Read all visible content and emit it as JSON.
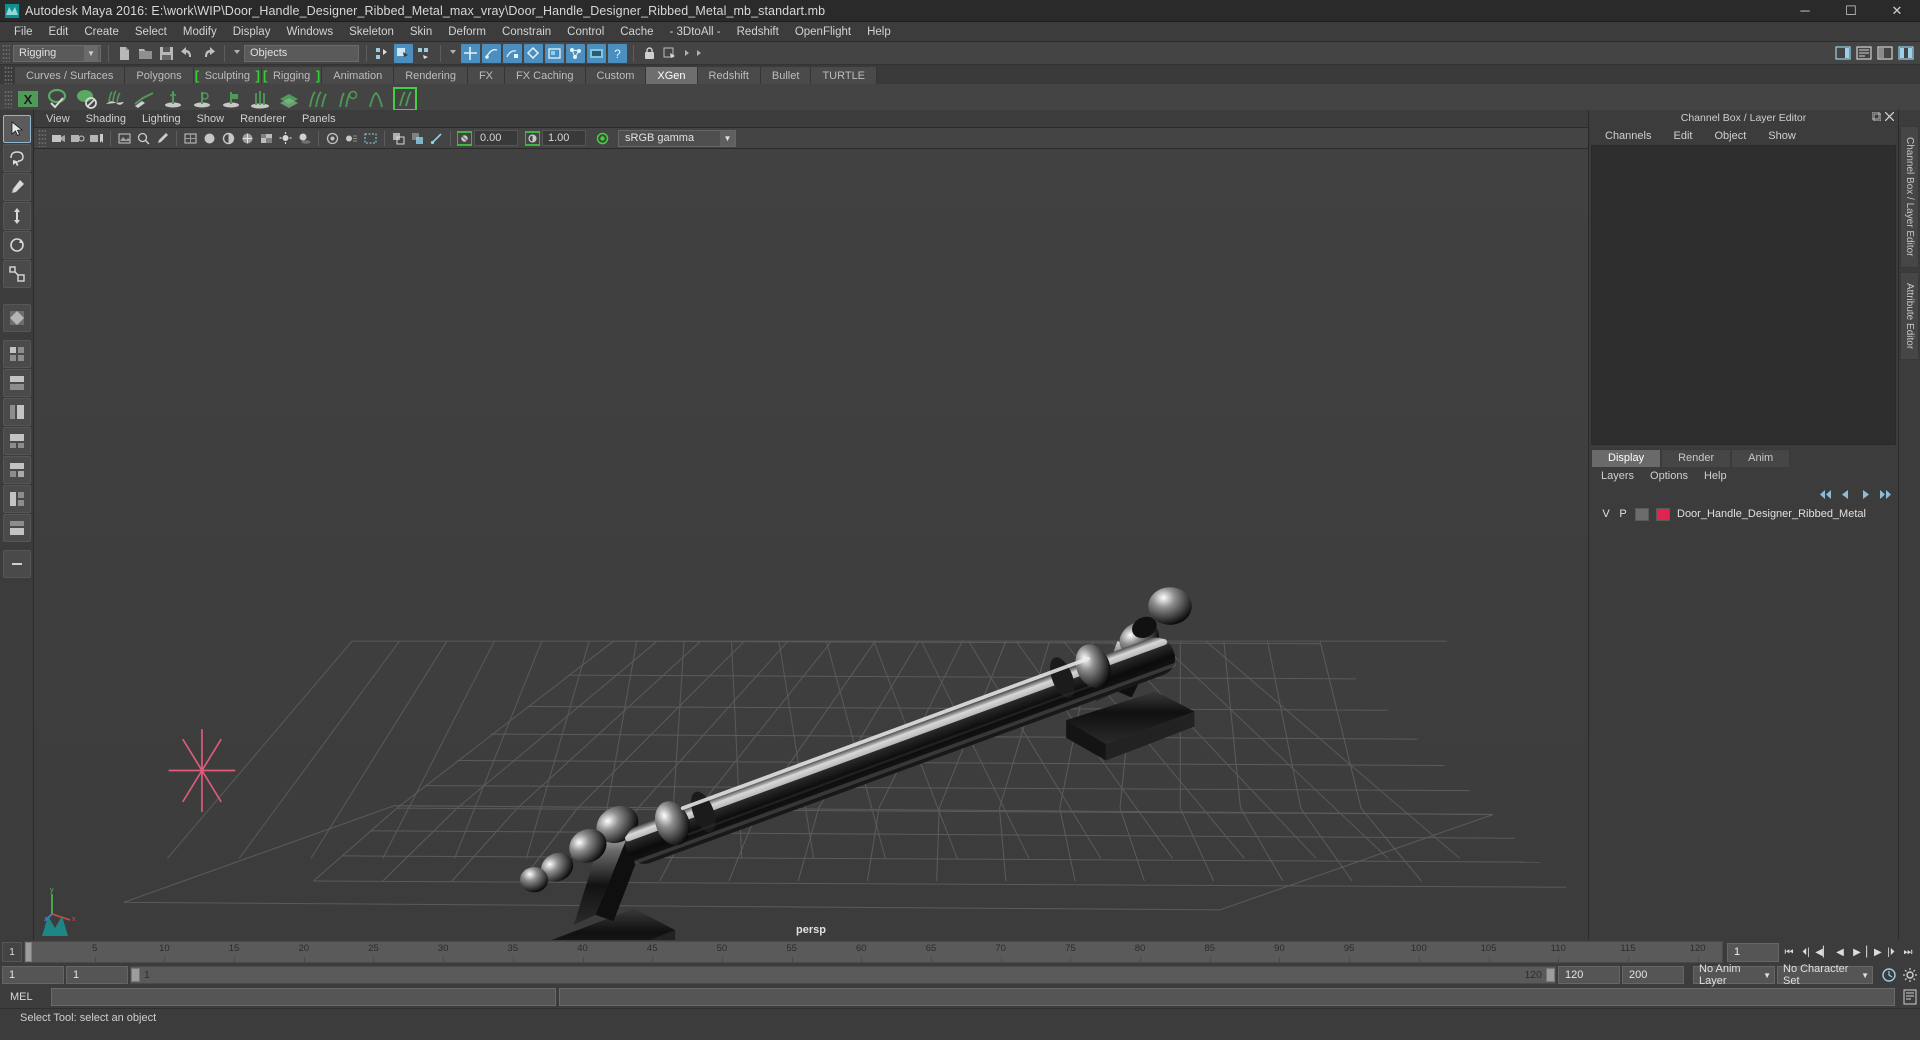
{
  "titlebar": {
    "title": "Autodesk Maya 2016: E:\\work\\WIP\\Door_Handle_Designer_Ribbed_Metal_max_vray\\Door_Handle_Designer_Ribbed_Metal_mb_standart.mb",
    "minimize": "─",
    "maximize": "☐",
    "close": "✕"
  },
  "menubar": {
    "items": [
      {
        "label": "File"
      },
      {
        "label": "Edit"
      },
      {
        "label": "Create"
      },
      {
        "label": "Select"
      },
      {
        "label": "Modify"
      },
      {
        "label": "Display"
      },
      {
        "label": "Windows"
      },
      {
        "label": "Skeleton"
      },
      {
        "label": "Skin"
      },
      {
        "label": "Deform"
      },
      {
        "label": "Constrain"
      },
      {
        "label": "Control"
      },
      {
        "label": "Cache"
      },
      {
        "label": "- 3DtoAll -"
      },
      {
        "label": "Redshift"
      },
      {
        "label": "OpenFlight"
      },
      {
        "label": "Help"
      }
    ]
  },
  "statusline": {
    "menuset": "Rigging",
    "selection_mask": "Objects",
    "arrow": "▼"
  },
  "shelf": {
    "tabs": [
      {
        "label": "Curves / Surfaces",
        "active": false,
        "lbracket": "",
        "rbracket": ""
      },
      {
        "label": "Polygons",
        "active": false,
        "lbracket": "",
        "rbracket": ""
      },
      {
        "label": "Sculpting",
        "active": false,
        "lbracket": "[",
        "rbracket": "]"
      },
      {
        "label": "Rigging",
        "active": false,
        "lbracket": "[",
        "rbracket": "]"
      },
      {
        "label": "Animation",
        "active": false,
        "lbracket": "",
        "rbracket": ""
      },
      {
        "label": "Rendering",
        "active": false,
        "lbracket": "",
        "rbracket": ""
      },
      {
        "label": "FX",
        "active": false,
        "lbracket": "",
        "rbracket": ""
      },
      {
        "label": "FX Caching",
        "active": false,
        "lbracket": "",
        "rbracket": ""
      },
      {
        "label": "Custom",
        "active": false,
        "lbracket": "",
        "rbracket": ""
      },
      {
        "label": "XGen",
        "active": true,
        "lbracket": "",
        "rbracket": ""
      },
      {
        "label": "Redshift",
        "active": false,
        "lbracket": "",
        "rbracket": ""
      },
      {
        "label": "Bullet",
        "active": false,
        "lbracket": "",
        "rbracket": ""
      },
      {
        "label": "TURTLE",
        "active": false,
        "lbracket": "",
        "rbracket": ""
      }
    ]
  },
  "viewport": {
    "menu": [
      {
        "label": "View"
      },
      {
        "label": "Shading"
      },
      {
        "label": "Lighting"
      },
      {
        "label": "Show"
      },
      {
        "label": "Renderer"
      },
      {
        "label": "Panels"
      }
    ],
    "exposure": "0.00",
    "gamma": "1.00",
    "colorspace": "sRGB gamma",
    "camera_label": "persp",
    "axis_x": "x",
    "axis_y": "y",
    "axis_z": "z"
  },
  "channelbox": {
    "panel_title": "Channel Box / Layer Editor",
    "tabs": [
      {
        "label": "Channels"
      },
      {
        "label": "Edit"
      },
      {
        "label": "Object"
      },
      {
        "label": "Show"
      }
    ]
  },
  "layereditor": {
    "tabs": [
      {
        "label": "Display",
        "active": true
      },
      {
        "label": "Render",
        "active": false
      },
      {
        "label": "Anim",
        "active": false
      }
    ],
    "menu": [
      {
        "label": "Layers"
      },
      {
        "label": "Options"
      },
      {
        "label": "Help"
      }
    ],
    "layers": [
      {
        "visible": "V",
        "playback": "P",
        "color": "#e0244f",
        "name": "Door_Handle_Designer_Ribbed_Metal"
      }
    ]
  },
  "edge_tabs": [
    {
      "label": "Channel Box / Layer Editor"
    },
    {
      "label": "Attribute Editor"
    }
  ],
  "timeline": {
    "start_label": "1",
    "ticks": [
      "5",
      "10",
      "15",
      "20",
      "25",
      "30",
      "35",
      "40",
      "45",
      "50",
      "55",
      "60",
      "65",
      "70",
      "75",
      "80",
      "85",
      "90",
      "95",
      "100",
      "105",
      "110",
      "115",
      "120"
    ],
    "current_frame": "1",
    "playback_buttons": [
      {
        "name": "go-to-start",
        "glyph": "⏮"
      },
      {
        "name": "step-back-key",
        "glyph": "⏴|"
      },
      {
        "name": "step-back-frame",
        "glyph": "◀▏"
      },
      {
        "name": "play-backwards",
        "glyph": "◀"
      },
      {
        "name": "play-forwards",
        "glyph": "▶"
      },
      {
        "name": "step-forward-frame",
        "glyph": "▏▶"
      },
      {
        "name": "step-forward-key",
        "glyph": "|⏵"
      },
      {
        "name": "go-to-end",
        "glyph": "⏭"
      }
    ]
  },
  "range": {
    "anim_start": "1",
    "playback_start": "1",
    "slider_start": "1",
    "slider_end": "120",
    "playback_end": "120",
    "anim_end": "200",
    "anim_layer": "No Anim Layer",
    "character_set": "No Character Set",
    "arrow": "▼"
  },
  "command": {
    "label": "MEL",
    "input_value": "",
    "output_value": ""
  },
  "status": {
    "help_text": "Select Tool: select an object"
  },
  "colors": {
    "accent_blue": "#4a8fbf",
    "shelf_green": "#2fd12f",
    "layer_red": "#e0244f",
    "viewport_bg": "#3f3f3f",
    "grid": "#5a5a5a"
  }
}
